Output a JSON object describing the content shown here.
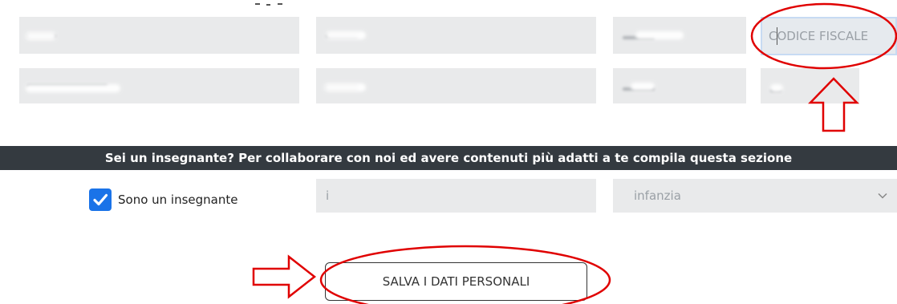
{
  "row1": {
    "codice_fiscale_placeholder": "CODICE FISCALE"
  },
  "banner": {
    "text": "Sei un insegnante? Per collaborare con noi ed avere contenuti più adatti a te compila questa sezione"
  },
  "teacher": {
    "checkbox_label": "Sono un insegnante",
    "checked": true,
    "subject_value": "i",
    "level_selected": "infanzia"
  },
  "save_button": {
    "label": "SALVA I DATI PERSONALI"
  },
  "colors": {
    "field_bg": "#e9eaeb",
    "banner_bg": "#343a40",
    "checkbox_blue": "#1a73e8",
    "annotation_red": "#e00000"
  }
}
